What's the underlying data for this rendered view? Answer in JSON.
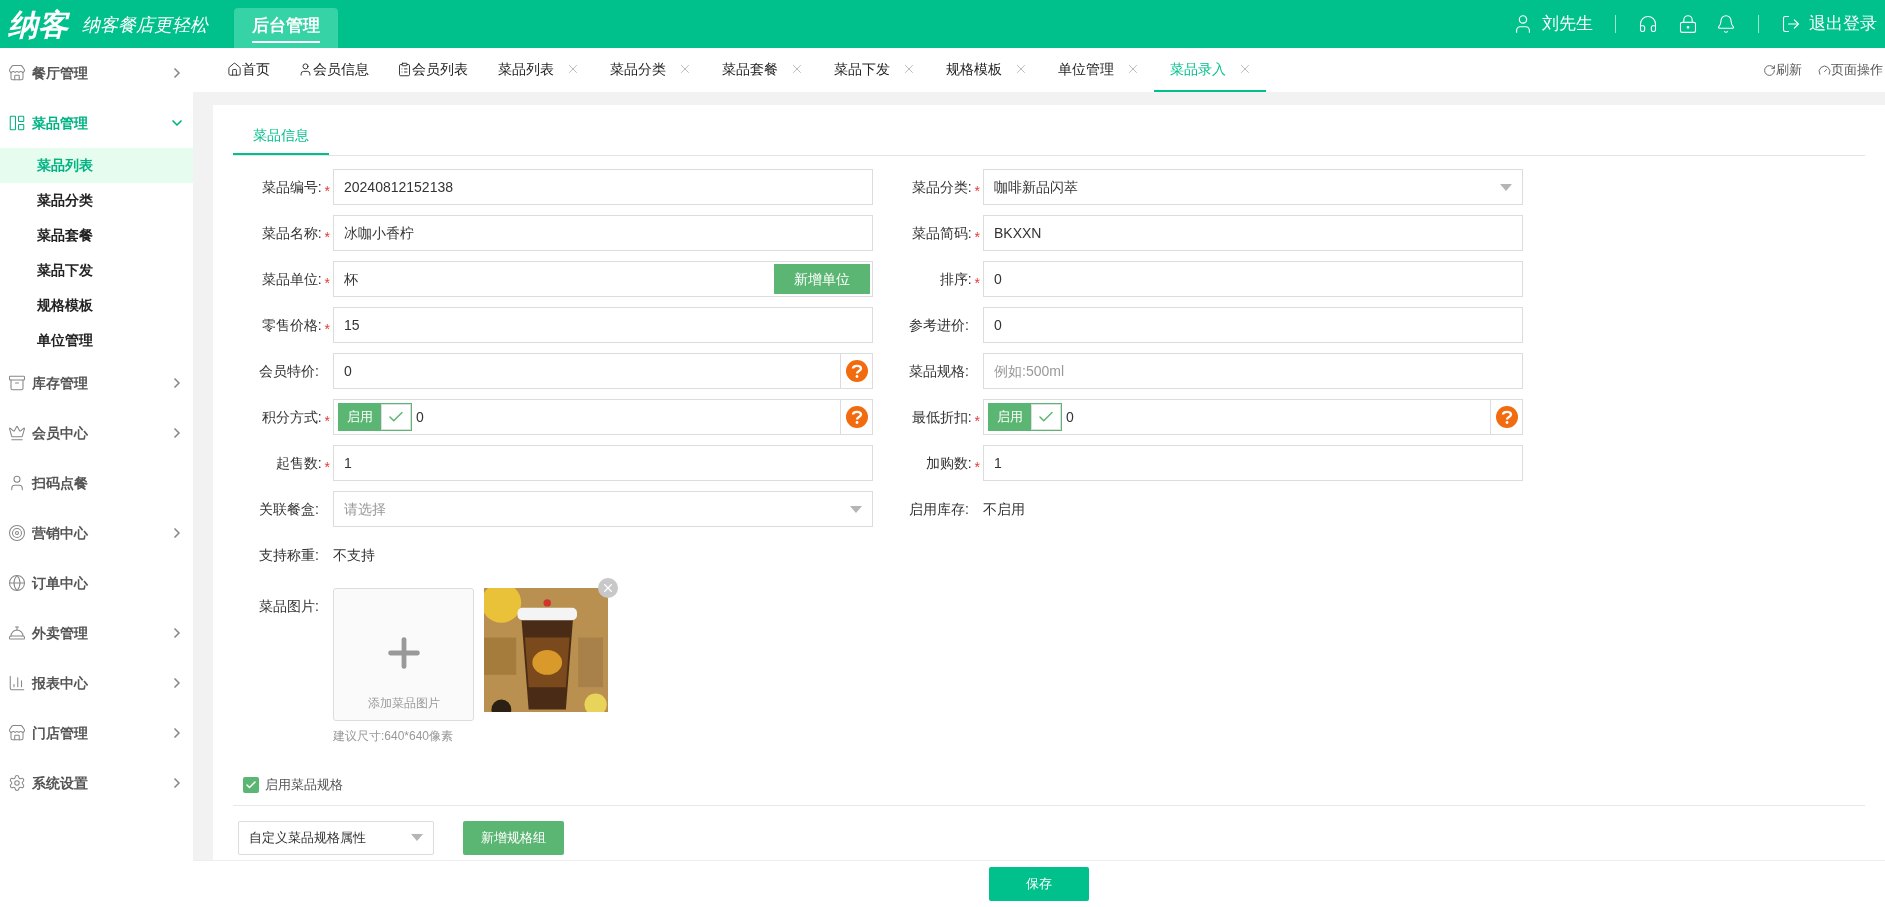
{
  "header": {
    "logo": "纳客",
    "slogan": "纳客餐店更轻松",
    "nav": [
      {
        "label": "后台管理",
        "selected": true
      }
    ],
    "user": "刘先生",
    "logout": "退出登录"
  },
  "sidebar": {
    "items": [
      {
        "label": "餐厅管理",
        "expanded": false,
        "has_arrow": true
      },
      {
        "label": "菜品管理",
        "expanded": true,
        "has_arrow": true,
        "children": [
          {
            "label": "菜品列表",
            "selected": true
          },
          {
            "label": "菜品分类",
            "selected": false
          },
          {
            "label": "菜品套餐",
            "selected": false
          },
          {
            "label": "菜品下发",
            "selected": false
          },
          {
            "label": "规格模板",
            "selected": false
          },
          {
            "label": "单位管理",
            "selected": false
          }
        ]
      },
      {
        "label": "库存管理",
        "expanded": false,
        "has_arrow": true
      },
      {
        "label": "会员中心",
        "expanded": false,
        "has_arrow": true
      },
      {
        "label": "扫码点餐",
        "expanded": false,
        "has_arrow": false
      },
      {
        "label": "营销中心",
        "expanded": false,
        "has_arrow": true
      },
      {
        "label": "订单中心",
        "expanded": false,
        "has_arrow": false
      },
      {
        "label": "外卖管理",
        "expanded": false,
        "has_arrow": true
      },
      {
        "label": "报表中心",
        "expanded": false,
        "has_arrow": true
      },
      {
        "label": "门店管理",
        "expanded": false,
        "has_arrow": true
      },
      {
        "label": "系统设置",
        "expanded": false,
        "has_arrow": true
      }
    ]
  },
  "tabs": [
    {
      "label": "首页",
      "selected": false,
      "closable": false,
      "kind": "home"
    },
    {
      "label": "会员信息",
      "selected": false,
      "closable": false,
      "kind": "user"
    },
    {
      "label": "会员列表",
      "selected": false,
      "closable": false,
      "kind": "list"
    },
    {
      "label": "菜品列表",
      "selected": false,
      "closable": true
    },
    {
      "label": "菜品分类",
      "selected": false,
      "closable": true
    },
    {
      "label": "菜品套餐",
      "selected": false,
      "closable": true
    },
    {
      "label": "菜品下发",
      "selected": false,
      "closable": true
    },
    {
      "label": "规格模板",
      "selected": false,
      "closable": true
    },
    {
      "label": "单位管理",
      "selected": false,
      "closable": true
    },
    {
      "label": "菜品录入",
      "selected": true,
      "closable": true
    }
  ],
  "tab_actions": [
    {
      "label": "刷新",
      "kind": "refresh"
    },
    {
      "label": "页面操作",
      "kind": "gauge"
    }
  ],
  "form_tabs": [
    {
      "label": "菜品信息",
      "selected": true
    }
  ],
  "fields_left": [
    {
      "kind": "input",
      "label": "菜品编号:",
      "required": true,
      "value": "20240812152138"
    },
    {
      "kind": "input",
      "label": "菜品名称:",
      "required": true,
      "value": "冰咖小香柠"
    },
    {
      "kind": "unit",
      "label": "菜品单位:",
      "required": true,
      "value": "杯",
      "button": "新增单位"
    },
    {
      "kind": "input",
      "label": "零售价格:",
      "required": true,
      "value": "15"
    },
    {
      "kind": "help",
      "label": "会员特价:",
      "required": false,
      "value": "0"
    },
    {
      "kind": "toggle",
      "label": "积分方式:",
      "required": true,
      "toggle_label": "启用",
      "on": true,
      "value": "0"
    },
    {
      "kind": "input",
      "label": "起售数:",
      "required": true,
      "value": "1"
    },
    {
      "kind": "select",
      "label": "关联餐盒:",
      "required": false,
      "placeholder": "请选择"
    },
    {
      "kind": "static",
      "label": "支持称重:",
      "required": false,
      "value": "不支持"
    }
  ],
  "fields_right": [
    {
      "kind": "select",
      "label": "菜品分类:",
      "required": true,
      "value": "咖啡新品闪萃"
    },
    {
      "kind": "input",
      "label": "菜品简码:",
      "required": true,
      "value": "BKXXN"
    },
    {
      "kind": "input",
      "label": "排序:",
      "required": true,
      "value": "0"
    },
    {
      "kind": "input",
      "label": "参考进价:",
      "required": false,
      "value": "0"
    },
    {
      "kind": "input",
      "label": "菜品规格:",
      "required": false,
      "placeholder": "例如:500ml"
    },
    {
      "kind": "toggle",
      "label": "最低折扣:",
      "required": true,
      "toggle_label": "启用",
      "on": true,
      "value": "0"
    },
    {
      "kind": "input",
      "label": "加购数:",
      "required": true,
      "value": "1"
    },
    {
      "kind": "static",
      "label": "启用库存:",
      "required": false,
      "value": "不启用"
    }
  ],
  "image_upload": {
    "label": "菜品图片:",
    "add_text": "添加菜品图片",
    "hint": "建议尺寸:640*640像素"
  },
  "spec_toggle": {
    "label": "启用菜品规格",
    "checked": true
  },
  "spec_select": {
    "value": "自定义菜品规格属性"
  },
  "spec_button": "新增规格组",
  "save_button": "保存",
  "required_mark": "*"
}
